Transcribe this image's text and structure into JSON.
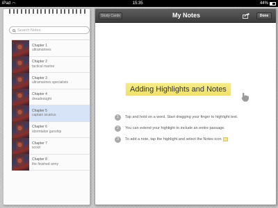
{
  "status_bar": {
    "carrier": "iPad",
    "time": "15:35",
    "battery": "44%"
  },
  "sidebar": {
    "search_placeholder": "Search Notes",
    "chapters": [
      {
        "number": "Chapter 1",
        "title": "ultramarines"
      },
      {
        "number": "Chapter 2",
        "title": "tactical marine"
      },
      {
        "number": "Chapter 3",
        "title": "ultramarines specialists"
      },
      {
        "number": "Chapter 4",
        "title": "dreadnought"
      },
      {
        "number": "Chapter 5",
        "title": "captain sicarius"
      },
      {
        "number": "Chapter 6",
        "title": "stormtalon gunship"
      },
      {
        "number": "Chapter 7",
        "title": "scout"
      },
      {
        "number": "Chapter 8",
        "title": "the finished army"
      }
    ],
    "selected_index": 4
  },
  "toolbar": {
    "study_cards_label": "Study Cards",
    "title": "My Notes",
    "done_label": "Done"
  },
  "main": {
    "heading": "Adding Highlights and Notes",
    "instructions": [
      {
        "step": "1",
        "text": "Tap and hold on a word. Start dragging your finger to highlight text."
      },
      {
        "step": "2",
        "text": "You can extend your highlight to include an entire passage."
      },
      {
        "step": "3",
        "text": "To add a note, tap the highlight and select the Notes icon"
      }
    ]
  },
  "colors": {
    "highlight": "#f0e26a",
    "selected_row": "#d7e3f6",
    "toolbar": "#4a4a4a"
  }
}
